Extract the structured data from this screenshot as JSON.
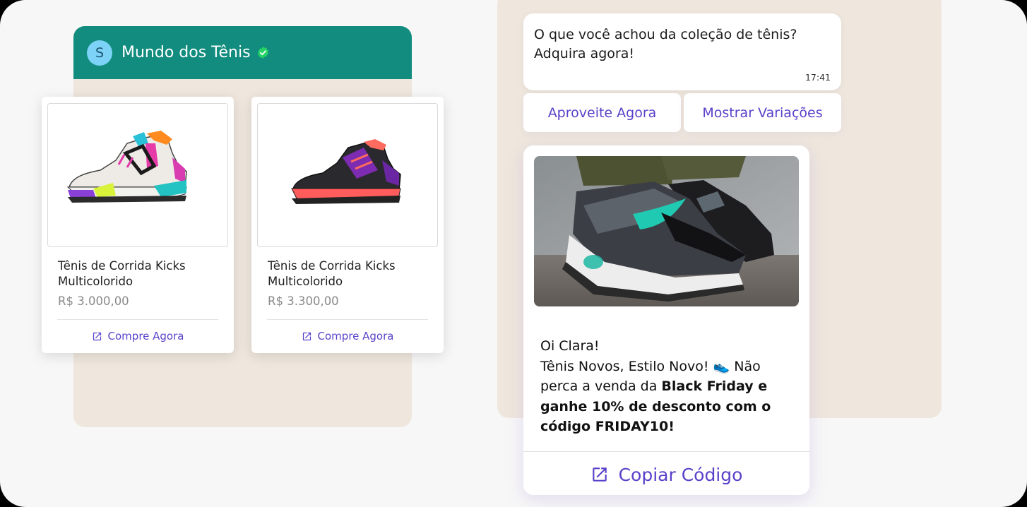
{
  "chat_left": {
    "avatar_letter": "S",
    "title": "Mundo dos Tênis",
    "verified_icon": "verified-check-icon",
    "header_color": "#128c7e"
  },
  "products": [
    {
      "name": "Tênis de Corrida Kicks Multicolorido",
      "price": "R$ 3.000,00",
      "button": "Compre Agora",
      "button_icon": "external-link-icon"
    },
    {
      "name": "Tênis de Corrida Kicks Multicolorido",
      "price": "R$ 3.300,00",
      "button": "Compre Agora",
      "button_icon": "external-link-icon"
    }
  ],
  "chat_right": {
    "message": "O que você achou da coleção de tênis? Adquira agora!",
    "time": "17:41",
    "quick_replies": [
      "Aproveite Agora",
      "Mostrar Variações"
    ],
    "promo": {
      "greeting": "Oi Clara!",
      "line_start": "Tênis Novos, Estilo Novo! ",
      "emoji": "👟",
      "line_mid": " Não perca a venda da ",
      "bold_text": "Black Friday e ganhe 10% de desconto com o código FRIDAY10!",
      "button": "Copiar Código",
      "button_icon": "external-link-icon"
    }
  },
  "colors": {
    "accent": "#5b41c9",
    "chat_bg": "#efe7dd",
    "verified": "#25d366"
  }
}
